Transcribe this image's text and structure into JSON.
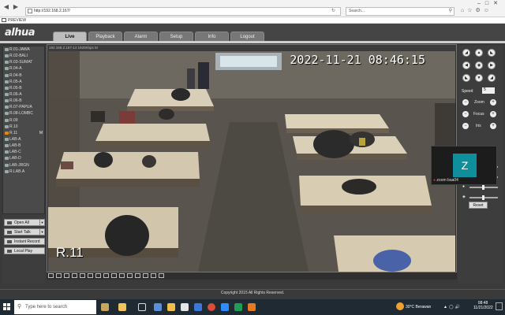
{
  "browser": {
    "url": "http://192.168.2.167/",
    "search_placeholder": "Search...",
    "tab_title": "PREVIEW"
  },
  "app": {
    "logo": "alhua",
    "nav_tabs": [
      "Live",
      "Playback",
      "Alarm",
      "Setup",
      "Info",
      "Logout"
    ],
    "active_tab": "Live",
    "channels": [
      {
        "label": "R.01-JAWA"
      },
      {
        "label": "R.02-BALI"
      },
      {
        "label": "R.03-SUMAT"
      },
      {
        "label": "R.04-A"
      },
      {
        "label": "R.04-B"
      },
      {
        "label": "R.05-A"
      },
      {
        "label": "R.05-B"
      },
      {
        "label": "R.06-A"
      },
      {
        "label": "R.06-B"
      },
      {
        "label": "R.07-PAPUA"
      },
      {
        "label": "R.08-LOMBC"
      },
      {
        "label": "R.09"
      },
      {
        "label": "R.10"
      },
      {
        "label": "R.11",
        "mark": "M"
      },
      {
        "label": "LAB-A"
      },
      {
        "label": "LAB-B"
      },
      {
        "label": "LAB-C"
      },
      {
        "label": "LAB-D"
      },
      {
        "label": "LAB-JRGN"
      },
      {
        "label": "R.LAB.A"
      }
    ],
    "selected_channel": "R.11",
    "controls": {
      "open_all": "Open All",
      "start_talk": "Start Talk",
      "instant_record": "Instant Record",
      "local_play": "Local Play"
    },
    "video": {
      "header": "192.168.2.167-14 1920Kbps M",
      "timestamp": "2022-11-21  08:46:15",
      "camera_name": "R.11"
    },
    "copyright": "Copyright 2015 All Rights Reserved."
  },
  "ptz": {
    "speed_label": "Speed",
    "speed_value": "5",
    "zoom_label": "Zoom",
    "focus_label": "Focus",
    "iris_label": "Iris",
    "reset_label": "Reset"
  },
  "zoom_popup": {
    "avatar_letter": "Z",
    "name": "zoom baa04"
  },
  "taskbar": {
    "search_placeholder": "Type here to search",
    "weather": "30°C  Berawan",
    "time": "08:48",
    "date": "11/21/2022"
  }
}
